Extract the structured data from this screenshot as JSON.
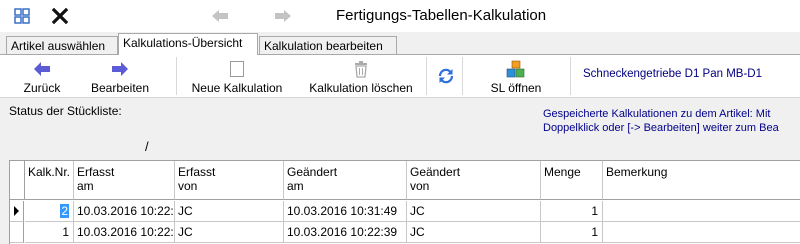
{
  "window": {
    "title": "Fertigungs-Tabellen-Kalkulation",
    "icons": [
      "grid-icon",
      "close-x-icon",
      "back-arrow-icon",
      "forward-arrow-icon"
    ]
  },
  "tabs": [
    {
      "label": "Artikel auswählen",
      "active": false
    },
    {
      "label": "Kalkulations-Übersicht",
      "active": true
    },
    {
      "label": "Kalkulation bearbeiten",
      "active": false
    }
  ],
  "toolbar": {
    "back_label": "Zurück",
    "edit_label": "Bearbeiten",
    "new_label": "Neue Kalkulation",
    "delete_label": "Kalkulation löschen",
    "sl_open_label": "SL öffnen",
    "product_name": "Schneckengetriebe D1 Pan MB-D1"
  },
  "status": {
    "label": "Status der Stückliste:",
    "slash": "/"
  },
  "info": {
    "line1": "Gespeicherte Kalkulationen zu dem Artikel: Mit",
    "line2": "Doppelklick oder [-> Bearbeiten] weiter zum Bea"
  },
  "grid": {
    "headers": [
      {
        "line1": "Kalk.Nr.",
        "line2": ""
      },
      {
        "line1": "Erfasst",
        "line2": "am"
      },
      {
        "line1": "Erfasst",
        "line2": "von"
      },
      {
        "line1": "Geändert",
        "line2": "am"
      },
      {
        "line1": "Geändert",
        "line2": "von"
      },
      {
        "line1": "Menge",
        "line2": ""
      },
      {
        "line1": "Bemerkung",
        "line2": ""
      }
    ],
    "rows": [
      {
        "nr": "2",
        "erfasst_am": "10.03.2016 10:22:",
        "erfasst_von": "JC",
        "geaendert_am": "10.03.2016 10:31:49",
        "geaendert_von": "JC",
        "menge": "1",
        "bemerkung": "",
        "current": true
      },
      {
        "nr": "1",
        "erfasst_am": "10.03.2016 10:22:",
        "erfasst_von": "JC",
        "geaendert_am": "10.03.2016 10:22:39",
        "geaendert_von": "JC",
        "menge": "1",
        "bemerkung": "",
        "current": false
      }
    ]
  },
  "colors": {
    "accent_blue": "#3399ff",
    "info_text": "#00008b",
    "product_text": "#000080",
    "arrow_blue": "#5b5bd6"
  }
}
